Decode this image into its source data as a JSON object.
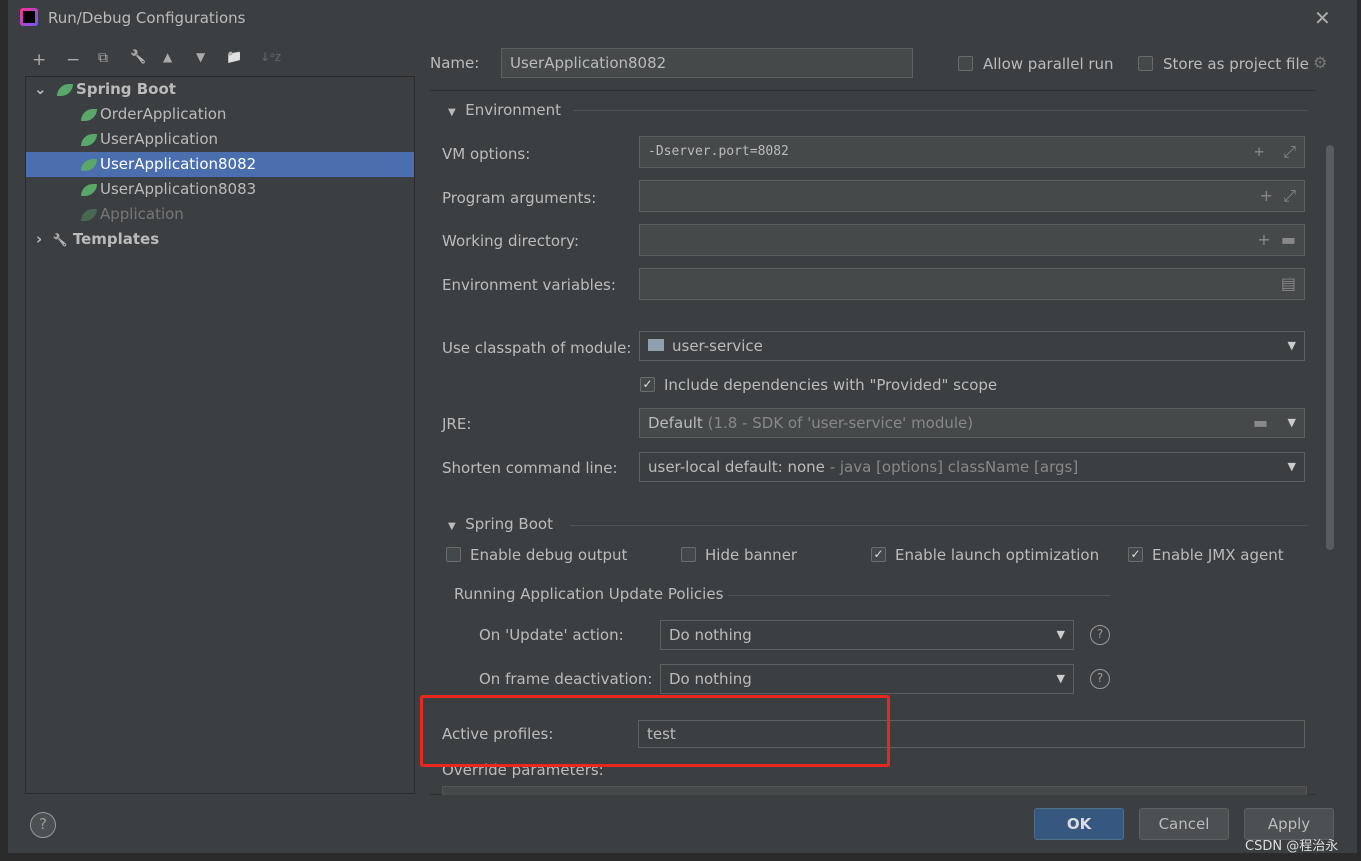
{
  "window": {
    "title": "Run/Debug Configurations",
    "close": "✕"
  },
  "toolbar": {
    "add": "+",
    "remove": "−",
    "copy": "⧉",
    "edit": "🔧",
    "up": "▲",
    "down": "▼",
    "folder": "📁",
    "sort": "↓ᵃz"
  },
  "tree": {
    "group": "Spring Boot",
    "items": [
      "OrderApplication",
      "UserApplication",
      "UserApplication8082",
      "UserApplication8083",
      "Application"
    ],
    "selected": "UserApplication8082",
    "templates": "Templates"
  },
  "form": {
    "name_label": "Name:",
    "name_value": "UserApplication8082",
    "allow_parallel": "Allow parallel run",
    "store_project": "Store as project file",
    "environment": "Environment",
    "vm_label": "VM options:",
    "vm_value": "-Dserver.port=8082",
    "args_label": "Program arguments:",
    "args_value": "",
    "workdir_label": "Working directory:",
    "workdir_value": "",
    "env_label": "Environment variables:",
    "env_value": "",
    "classpath_label": "Use classpath of module:",
    "classpath_value": "user-service",
    "include_deps": "Include dependencies with \"Provided\" scope",
    "jre_label": "JRE:",
    "jre_value": "Default",
    "jre_hint": "(1.8 - SDK of 'user-service' module)",
    "shorten_label": "Shorten command line:",
    "shorten_value": "user-local default: none",
    "shorten_hint": "- java [options] className [args]",
    "spring_boot": "Spring Boot",
    "debug_output": "Enable debug output",
    "hide_banner": "Hide banner",
    "launch_opt": "Enable launch optimization",
    "jmx": "Enable JMX agent",
    "policies": "Running Application Update Policies",
    "update_label": "On 'Update' action:",
    "update_value": "Do nothing",
    "frame_label": "On frame deactivation:",
    "frame_value": "Do nothing",
    "profiles_label": "Active profiles:",
    "profiles_value": "test",
    "override_label": "Override parameters:"
  },
  "checks": {
    "allow_parallel": false,
    "store_project": false,
    "include_deps": true,
    "debug_output": false,
    "hide_banner": false,
    "launch_opt": true,
    "jmx": true
  },
  "buttons": {
    "ok": "OK",
    "cancel": "Cancel",
    "apply": "Apply",
    "help": "?"
  },
  "watermark": "CSDN @程治永",
  "highlight_color": "#e8281e"
}
